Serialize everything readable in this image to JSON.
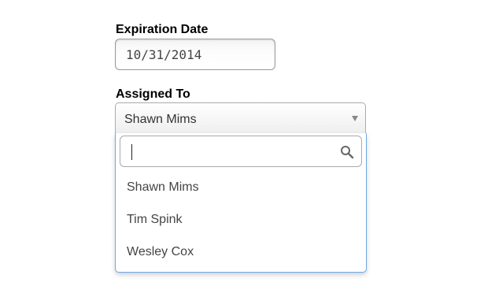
{
  "form": {
    "expiration": {
      "label": "Expiration Date",
      "value": "10/31/2014"
    },
    "assigned": {
      "label": "Assigned To",
      "selected": "Shawn Mims",
      "search_value": "",
      "options": [
        {
          "label": "Shawn Mims"
        },
        {
          "label": "Tim Spink"
        },
        {
          "label": "Wesley Cox"
        }
      ]
    }
  },
  "icons": {
    "search": "search-icon",
    "dropdown_arrow": "triangle-down-icon"
  },
  "colors": {
    "focus_border": "#6ea8e6",
    "input_border": "#aaaaaa",
    "label_text": "#000000"
  }
}
